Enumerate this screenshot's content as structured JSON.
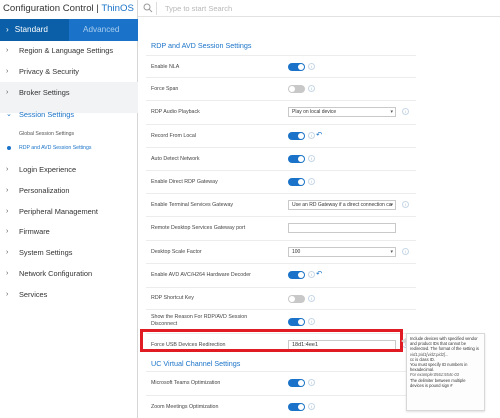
{
  "app": {
    "title_prefix": "Configuration Control | ",
    "title_brand": "ThinOS"
  },
  "mode_tabs": {
    "standard": "Standard",
    "advanced": "Advanced"
  },
  "search": {
    "placeholder": "Type to start Search",
    "value": ""
  },
  "sidebar": {
    "items": [
      {
        "label": "Region & Language Settings"
      },
      {
        "label": "Privacy & Security"
      },
      {
        "label": "Broker Settings"
      },
      {
        "label": "Session Settings"
      },
      {
        "label": "Login Experience"
      },
      {
        "label": "Personalization"
      },
      {
        "label": "Peripheral Management"
      },
      {
        "label": "Firmware"
      },
      {
        "label": "System Settings"
      },
      {
        "label": "Network Configuration"
      },
      {
        "label": "Services"
      }
    ],
    "sub_items": [
      {
        "label": "Global Session Settings"
      },
      {
        "label": "RDP and AVD Session Settings"
      }
    ]
  },
  "main": {
    "section1_title": "RDP and AVD Session Settings",
    "section2_title": "UC Virtual Channel Settings",
    "rows": [
      {
        "label": "Enable NLA",
        "control": "toggle",
        "on": true
      },
      {
        "label": "Force Span",
        "control": "toggle",
        "on": false
      },
      {
        "label": "RDP Audio Playback",
        "control": "select",
        "value": "Play on local device"
      },
      {
        "label": "Record From Local",
        "control": "toggle",
        "on": true
      },
      {
        "label": "Auto Detect Network",
        "control": "toggle",
        "on": true
      },
      {
        "label": "Enable Direct RDP Gateway",
        "control": "toggle",
        "on": true
      },
      {
        "label": "Enable Terminal Services Gateway",
        "control": "select",
        "value": "Use an RD Gateway if a direct connection ca"
      },
      {
        "label": "Remote Desktop Services Gateway port",
        "control": "text",
        "value": ""
      },
      {
        "label": "Desktop Scale Factor",
        "control": "select",
        "value": "100"
      },
      {
        "label": "Enable AVD AVC/H264 Hardware Decoder",
        "control": "toggle",
        "on": true
      },
      {
        "label": "RDP Shortcut Key",
        "control": "toggle",
        "on": false
      },
      {
        "label_line1": "Show the Reason For RDP/AVD Session",
        "label_line2": "Disconnect",
        "control": "toggle",
        "on": true
      },
      {
        "label": "Force USB Devices Redirection",
        "control": "text",
        "value": "18d1:4ee1"
      }
    ],
    "uc_rows": [
      {
        "label": "Microsoft Teams Optimization",
        "control": "toggle",
        "on": true
      },
      {
        "label": "Zoom Meetings Optimization",
        "control": "toggle",
        "on": true
      }
    ]
  },
  "tooltip": {
    "lines": [
      "Include devices with specified vendor",
      "and product IDs that cannot be",
      "redirected. The format of the setting is",
      "vid1:pid1[vid2:pid2]...",
      "cc is class ID.",
      "You must specify ID numbers in",
      "hexadecimal.",
      "For example:0561:554c-03",
      "The delimiter between multiple",
      "devices is pound sign #"
    ]
  },
  "colors": {
    "accent": "#1a73c8",
    "sidebar_active": "#0a5fa8",
    "highlight": "#e01b24",
    "toggle_off": "#c8c8c8"
  },
  "icons": {
    "search": "search-icon",
    "info": "info-icon",
    "reset": "reset-icon",
    "chevron": "chevron-right-icon"
  }
}
